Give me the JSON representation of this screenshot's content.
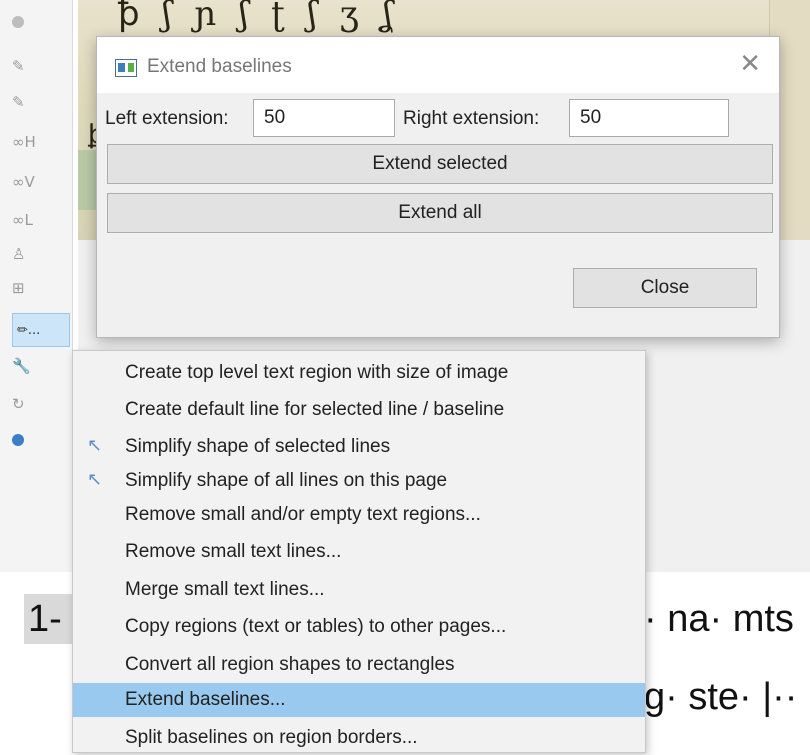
{
  "toolbar": {
    "items": [
      {
        "icon": "circle-icon",
        "label": ""
      },
      {
        "icon": "simplify-icon",
        "label": ""
      },
      {
        "icon": "simplify-icon",
        "label": ""
      },
      {
        "icon": "link-icon",
        "label": "H"
      },
      {
        "icon": "link-icon",
        "label": "V"
      },
      {
        "icon": "link-icon",
        "label": "L"
      },
      {
        "icon": "person-icon",
        "label": ""
      },
      {
        "icon": "table-icon",
        "label": ""
      },
      {
        "icon": "edit-icon",
        "label": "..."
      },
      {
        "icon": "wrench-icon",
        "label": ""
      },
      {
        "icon": "redo-icon",
        "label": ""
      },
      {
        "icon": "help-icon",
        "label": ""
      }
    ]
  },
  "dialog": {
    "title": "Extend baselines",
    "left_label": "Left extension:",
    "left_value": "50",
    "right_label": "Right extension:",
    "right_value": "50",
    "extend_selected": "Extend selected",
    "extend_all": "Extend all",
    "close": "Close"
  },
  "menu": {
    "items": [
      {
        "label": "Create top level text region with size of image",
        "icon": ""
      },
      {
        "label": "Create default line for selected line / baseline",
        "icon": ""
      },
      {
        "label": "Simplify shape of selected lines",
        "icon": "simplify-icon"
      },
      {
        "label": "Simplify shape of all lines on this page",
        "icon": "simplify-icon"
      },
      {
        "label": "Remove small and/or empty text regions...",
        "icon": ""
      },
      {
        "label": "Remove small text lines...",
        "icon": ""
      },
      {
        "label": "Merge small text lines...",
        "icon": ""
      },
      {
        "label": "Copy regions (text or tables) to other pages...",
        "icon": ""
      },
      {
        "label": "Convert all region shapes to rectangles",
        "icon": ""
      },
      {
        "label": "Extend baselines...",
        "icon": ""
      },
      {
        "label": "Split baselines on region borders...",
        "icon": ""
      }
    ],
    "highlighted_index": 9
  },
  "transcription": {
    "line_number": "1-",
    "line1_text": "· na· mts",
    "line2_text": "g· ste· |··"
  },
  "colors": {
    "highlight": "#99c9ef",
    "dialog_bg": "#f0f0f0",
    "menu_bg": "#f2f2f2"
  }
}
